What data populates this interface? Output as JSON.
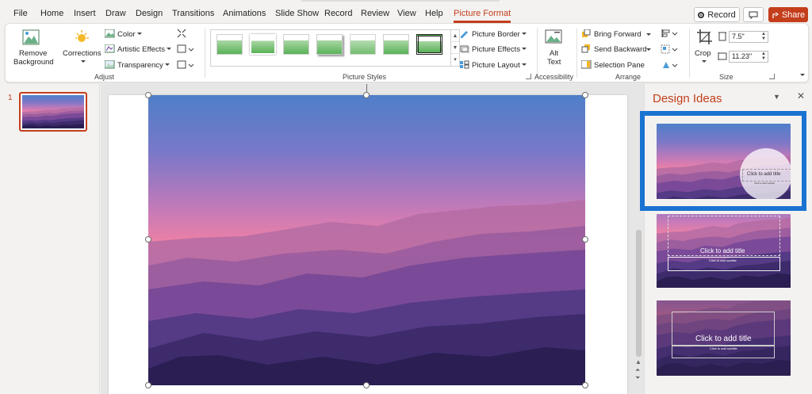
{
  "tabs": [
    "File",
    "Home",
    "Insert",
    "Draw",
    "Design",
    "Transitions",
    "Animations",
    "Slide Show",
    "Record",
    "Review",
    "View",
    "Help",
    "Picture Format"
  ],
  "topright": {
    "record": "Record",
    "share": "Share"
  },
  "adjust": {
    "remove_bg": [
      "Remove",
      "Background"
    ],
    "corrections": "Corrections",
    "color": "Color",
    "artistic": "Artistic Effects",
    "transparency": "Transparency",
    "label": "Adjust"
  },
  "picture_styles": {
    "border": "Picture Border",
    "effects": "Picture Effects",
    "layout": "Picture Layout",
    "label": "Picture Styles"
  },
  "accessibility": {
    "alt": [
      "Alt",
      "Text"
    ],
    "label": "Accessibility"
  },
  "arrange": {
    "bring_forward": "Bring Forward",
    "send_backward": "Send Backward",
    "selection_pane": "Selection Pane",
    "label": "Arrange"
  },
  "size": {
    "crop": "Crop",
    "height": "7.5\"",
    "width": "11.23\"",
    "label": "Size"
  },
  "thumb_number": "1",
  "design_ideas": {
    "title": "Design Ideas",
    "idea1": {
      "title": "Click to add title",
      "subtitle": "Click to add subtitle"
    },
    "idea2": {
      "title": "Click to add title",
      "subtitle": "Click to add subtitle"
    },
    "idea3": {
      "title": "Click to add title",
      "subtitle": "Click to add subtitle"
    }
  },
  "colors": {
    "accent": "#c43e1c",
    "highlight": "#1a73d1"
  }
}
